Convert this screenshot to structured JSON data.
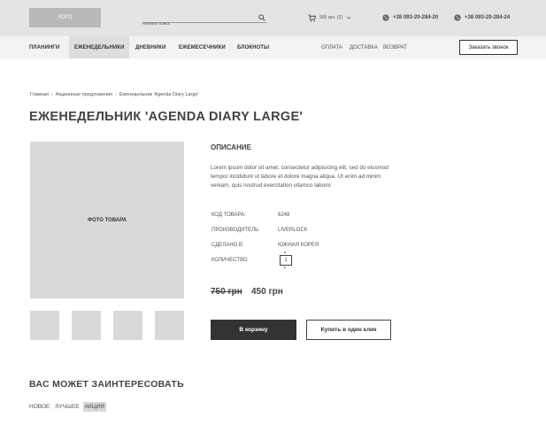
{
  "header": {
    "logo": "ЛОГО",
    "search_placeholder": "Начните поиск",
    "cart_text": "900 грн. (2)",
    "phone1": "+38 093-20-284-20",
    "phone2": "+38 093-20-284-24"
  },
  "nav": {
    "items": [
      "Планинги",
      "Еженедельники",
      "Дневники",
      "Ежемесечники",
      "Блокноты"
    ],
    "active_index": 1,
    "right_links": [
      "Оплата",
      "Доставка",
      "Возврат"
    ],
    "callback_label": "Заказать звонок"
  },
  "breadcrumb": [
    "Главная",
    "Акционные предложения",
    "Еженедельник 'Agenda Diary Large'"
  ],
  "product": {
    "title": "ЕЖЕНЕДЕЛЬНИК 'AGENDA DIARY LARGE'",
    "photo_label": "ФОТО ТОВАРА",
    "description_title": "ОПИСАНИЕ",
    "description": "Lorem ipsum dolor sit amet, consectetur adipisicing elit, sed do eiusmod tempor incididunt ut labore et dolore magna aliqua. Ut enim ad minim veniam, quis nostrud exercitation ullamco laboris",
    "props": [
      {
        "label": "Код товара:",
        "value": "6248"
      },
      {
        "label": "Производитель:",
        "value": "LIVERLOCK"
      },
      {
        "label": "Сделано в:",
        "value": "Южная Корея"
      },
      {
        "label": "Количество",
        "value": ""
      }
    ],
    "quantity": "1",
    "old_price": "750 грн",
    "new_price": "450 грн",
    "add_to_cart": "В корзину",
    "buy_one_click": "Купить в один клик"
  },
  "related": {
    "title": "ВАС МОЖЕТ ЗАИНТЕРЕСОВАТЬ",
    "tabs": [
      "Новое",
      "Лучшее",
      "Акция"
    ],
    "active_tab": 2
  },
  "colors": {
    "topbar": "#e4e4e4",
    "navbar": "#f2f2f2",
    "placeholder_gray": "#d9d9d9",
    "dark_button": "#333333"
  }
}
